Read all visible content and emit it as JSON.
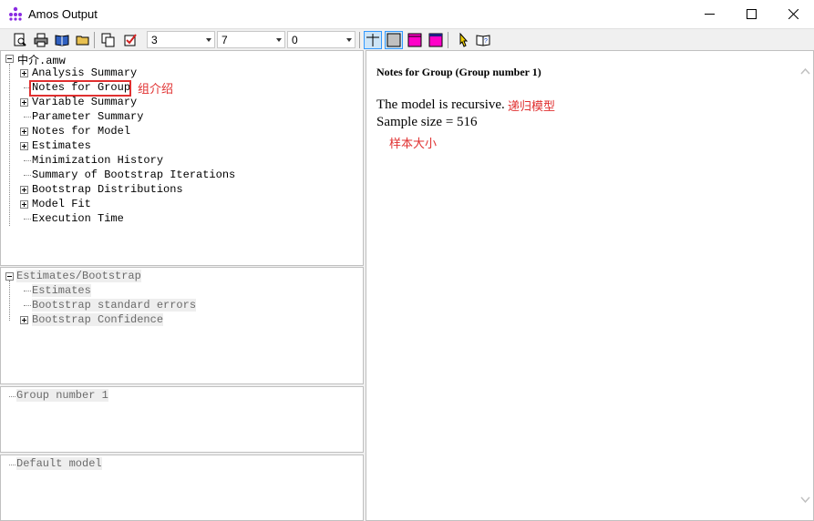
{
  "window": {
    "title": "Amos Output"
  },
  "toolbar": {
    "combo1": "3",
    "combo2": "7",
    "combo3": "0"
  },
  "tree": {
    "root": "中介.amw",
    "items": [
      "Analysis Summary",
      "Notes for Group",
      "Variable Summary",
      "Parameter Summary",
      "Notes for Model",
      "Estimates",
      "Minimization History",
      "Summary of Bootstrap Iterations",
      "Bootstrap Distributions",
      "Model Fit",
      "Execution Time"
    ]
  },
  "estimates_panel": {
    "root": "Estimates/Bootstrap",
    "items": [
      "Estimates",
      "Bootstrap standard errors",
      "Bootstrap Confidence"
    ]
  },
  "group_panel": {
    "item": "Group number 1"
  },
  "model_panel": {
    "item": "Default model"
  },
  "output": {
    "heading": "Notes for Group (Group number 1)",
    "line1": "The model is recursive.",
    "line2": "Sample size = 516"
  },
  "annotations": {
    "group_intro": "组介绍",
    "recursive": "递归模型",
    "sample_size": "样本大小"
  },
  "colors": {
    "annotation": "#e03030",
    "highlight_box": "#e03030"
  }
}
